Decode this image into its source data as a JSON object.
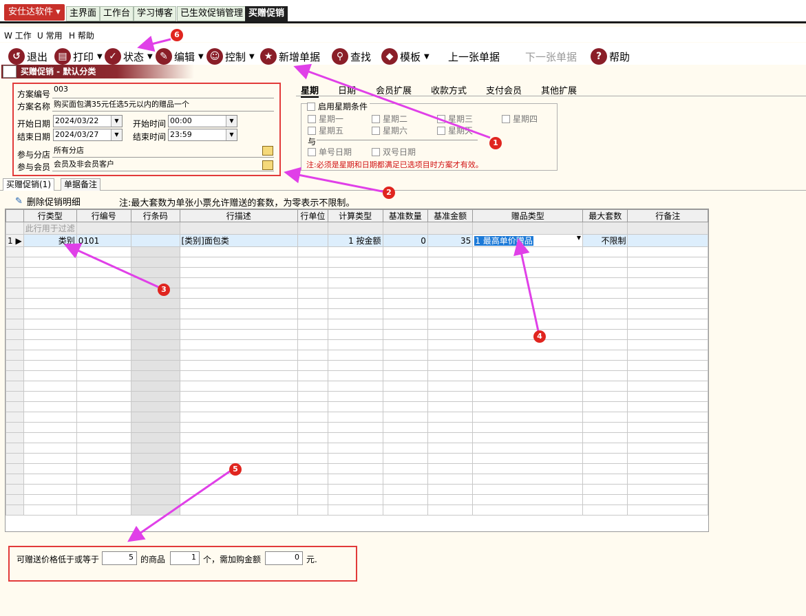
{
  "app": {
    "brand": "安仕达软件"
  },
  "tabs": [
    "主界面",
    "工作台",
    "学习博客",
    "已生效促销管理",
    "买赠促销"
  ],
  "menu": [
    "W 工作",
    "U 常用",
    "H 帮助"
  ],
  "toolbar": {
    "exit": "退出",
    "print": "打印",
    "status": "状态",
    "edit": "编辑",
    "control": "控制",
    "new_doc": "新增单据",
    "find": "查找",
    "template": "模板",
    "prev": "上一张单据",
    "next": "下一张单据",
    "help": "帮助"
  },
  "title": "买赠促销 - 默认分类",
  "form": {
    "code_label": "方案编号",
    "code": "003",
    "name_label": "方案名称",
    "name": "购买面包满35元任选5元以内的赠品一个",
    "start_date_label": "开始日期",
    "start_date": "2024/03/22",
    "start_time_label": "开始时间",
    "start_time": "00:00",
    "end_date_label": "结束日期",
    "end_date": "2024/03/27",
    "end_time_label": "结束时间",
    "end_time": "23:59",
    "branch_label": "参与分店",
    "branch": "所有分店",
    "member_label": "参与会员",
    "member": "会员及非会员客户"
  },
  "right_tabs": [
    "星期",
    "日期",
    "会员扩展",
    "收款方式",
    "支付会员",
    "其他扩展"
  ],
  "week": {
    "enable": "启用星期条件",
    "days": [
      "星期一",
      "星期二",
      "星期三",
      "星期四",
      "星期五",
      "星期六",
      "星期天"
    ],
    "and": "与",
    "odd": "单号日期",
    "even": "双号日期",
    "note": "注:必须是星期和日期都满足已选项目时方案才有效。"
  },
  "bottom_tabs": [
    "买赠促销(1)",
    "单据备注"
  ],
  "detail": {
    "delete_label": "删除促销明细",
    "note": "注:最大套数为单张小票允许赠送的套数，为零表示不限制。"
  },
  "grid": {
    "columns": [
      "行类型",
      "行编号",
      "行条码",
      "行描述",
      "行单位",
      "计算类型",
      "基准数量",
      "基准金额",
      "赠品类型",
      "最大套数",
      "行备注"
    ],
    "filter_hint": "此行用于过滤",
    "rows": [
      {
        "indicator": "1",
        "type": "类别",
        "code": "0101",
        "barcode": "",
        "desc": "[类别]面包类",
        "unit": "",
        "calc": "1 按金额",
        "qty": "0",
        "amount": "35",
        "gift": "1 最高单价赠品",
        "max": "不限制",
        "remark": ""
      }
    ]
  },
  "footer": {
    "t1": "可赠送价格低于或等于",
    "v1": "5",
    "t2": "的商品",
    "v2": "1",
    "t3": "个，需加购金额",
    "v3": "0",
    "t4": "元."
  },
  "annotations": [
    "1",
    "2",
    "3",
    "4",
    "5",
    "6"
  ],
  "colors": {
    "brand": "#c8302a",
    "icon": "#8a1e28",
    "annotation": "#e0251f",
    "arrow": "#e040e8"
  }
}
